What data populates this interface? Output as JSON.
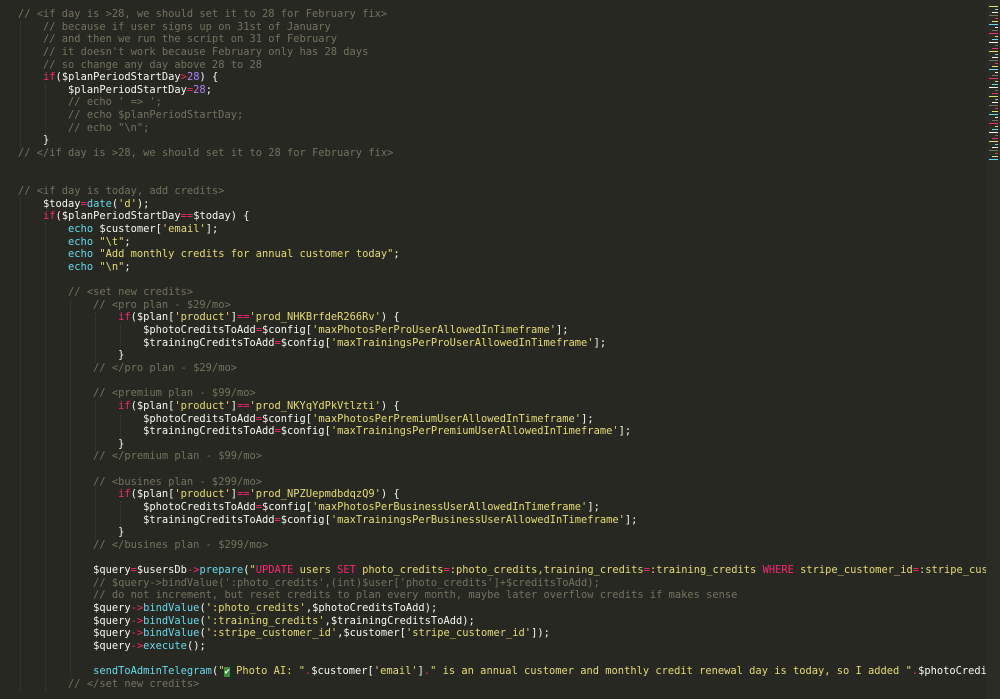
{
  "editor": {
    "lines": [
      {
        "indent": 0,
        "tokens": [
          [
            "c",
            "// <if day is >28, we should set it to 28 for February fix>"
          ]
        ]
      },
      {
        "indent": 1,
        "tokens": [
          [
            "c",
            "// because if user signs up on 31st of January"
          ]
        ]
      },
      {
        "indent": 1,
        "tokens": [
          [
            "c",
            "// and then we run the script on 31 of February"
          ]
        ]
      },
      {
        "indent": 1,
        "tokens": [
          [
            "c",
            "// it doesn't work because February only has 28 days"
          ]
        ]
      },
      {
        "indent": 1,
        "tokens": [
          [
            "c",
            "// so change any day above 28 to 28"
          ]
        ]
      },
      {
        "indent": 1,
        "tokens": [
          [
            "k",
            "if"
          ],
          [
            "p",
            "("
          ],
          [
            "v",
            "$planPeriodStartDay"
          ],
          [
            "o",
            ">"
          ],
          [
            "n",
            "28"
          ],
          [
            "p",
            ") {"
          ]
        ]
      },
      {
        "indent": 2,
        "tokens": [
          [
            "v",
            "$planPeriodStartDay"
          ],
          [
            "o",
            "="
          ],
          [
            "n",
            "28"
          ],
          [
            "p",
            ";"
          ]
        ]
      },
      {
        "indent": 2,
        "tokens": [
          [
            "c",
            "// echo ' => ';"
          ]
        ]
      },
      {
        "indent": 2,
        "tokens": [
          [
            "c",
            "// echo $planPeriodStartDay;"
          ]
        ]
      },
      {
        "indent": 2,
        "tokens": [
          [
            "c",
            "// echo \"\\n\";"
          ]
        ]
      },
      {
        "indent": 1,
        "tokens": [
          [
            "p",
            "}"
          ]
        ]
      },
      {
        "indent": 0,
        "tokens": [
          [
            "c",
            "// </if day is >28, we should set it to 28 for February fix>"
          ]
        ]
      },
      {
        "indent": 0,
        "tokens": []
      },
      {
        "indent": 0,
        "tokens": []
      },
      {
        "indent": 0,
        "tokens": [
          [
            "c",
            "// <if day is today, add credits>"
          ]
        ]
      },
      {
        "indent": 1,
        "tokens": [
          [
            "v",
            "$today"
          ],
          [
            "o",
            "="
          ],
          [
            "f",
            "date"
          ],
          [
            "p",
            "("
          ],
          [
            "s",
            "'d'"
          ],
          [
            "p",
            ");"
          ]
        ]
      },
      {
        "indent": 1,
        "tokens": [
          [
            "k",
            "if"
          ],
          [
            "p",
            "("
          ],
          [
            "v",
            "$planPeriodStartDay"
          ],
          [
            "o",
            "=="
          ],
          [
            "v",
            "$today"
          ],
          [
            "p",
            ") {"
          ]
        ]
      },
      {
        "indent": 2,
        "tokens": [
          [
            "f",
            "echo"
          ],
          [
            "p",
            " "
          ],
          [
            "v",
            "$customer"
          ],
          [
            "p",
            "["
          ],
          [
            "s",
            "'email'"
          ],
          [
            "p",
            "];"
          ]
        ]
      },
      {
        "indent": 2,
        "tokens": [
          [
            "f",
            "echo"
          ],
          [
            "p",
            " "
          ],
          [
            "s",
            "\"\\t\""
          ],
          [
            "p",
            ";"
          ]
        ]
      },
      {
        "indent": 2,
        "tokens": [
          [
            "f",
            "echo"
          ],
          [
            "p",
            " "
          ],
          [
            "s",
            "\"Add monthly credits for annual customer today\""
          ],
          [
            "p",
            ";"
          ]
        ]
      },
      {
        "indent": 2,
        "tokens": [
          [
            "f",
            "echo"
          ],
          [
            "p",
            " "
          ],
          [
            "s",
            "\"\\n\""
          ],
          [
            "p",
            ";"
          ]
        ]
      },
      {
        "indent": 0,
        "tokens": []
      },
      {
        "indent": 2,
        "tokens": [
          [
            "c",
            "// <set new credits>"
          ]
        ]
      },
      {
        "indent": 3,
        "tokens": [
          [
            "c",
            "// <pro plan - $29/mo>"
          ]
        ]
      },
      {
        "indent": 4,
        "tokens": [
          [
            "k",
            "if"
          ],
          [
            "p",
            "("
          ],
          [
            "v",
            "$plan"
          ],
          [
            "p",
            "["
          ],
          [
            "s",
            "'product'"
          ],
          [
            "p",
            "]"
          ],
          [
            "o",
            "=="
          ],
          [
            "s",
            "'prod_NHKBrfdeR266Rv'"
          ],
          [
            "p",
            ") {"
          ]
        ]
      },
      {
        "indent": 5,
        "tokens": [
          [
            "v",
            "$photoCreditsToAdd"
          ],
          [
            "o",
            "="
          ],
          [
            "v",
            "$config"
          ],
          [
            "p",
            "["
          ],
          [
            "s",
            "'maxPhotosPerProUserAllowedInTimeframe'"
          ],
          [
            "p",
            "];"
          ]
        ]
      },
      {
        "indent": 5,
        "tokens": [
          [
            "v",
            "$trainingCreditsToAdd"
          ],
          [
            "o",
            "="
          ],
          [
            "v",
            "$config"
          ],
          [
            "p",
            "["
          ],
          [
            "s",
            "'maxTrainingsPerProUserAllowedInTimeframe'"
          ],
          [
            "p",
            "];"
          ]
        ]
      },
      {
        "indent": 4,
        "tokens": [
          [
            "p",
            "}"
          ]
        ]
      },
      {
        "indent": 3,
        "tokens": [
          [
            "c",
            "// </pro plan - $29/mo>"
          ]
        ]
      },
      {
        "indent": 0,
        "tokens": []
      },
      {
        "indent": 3,
        "tokens": [
          [
            "c",
            "// <premium plan - $99/mo>"
          ]
        ]
      },
      {
        "indent": 4,
        "tokens": [
          [
            "k",
            "if"
          ],
          [
            "p",
            "("
          ],
          [
            "v",
            "$plan"
          ],
          [
            "p",
            "["
          ],
          [
            "s",
            "'product'"
          ],
          [
            "p",
            "]"
          ],
          [
            "o",
            "=="
          ],
          [
            "s",
            "'prod_NKYqYdPkVtlzti'"
          ],
          [
            "p",
            ") {"
          ]
        ]
      },
      {
        "indent": 5,
        "tokens": [
          [
            "v",
            "$photoCreditsToAdd"
          ],
          [
            "o",
            "="
          ],
          [
            "v",
            "$config"
          ],
          [
            "p",
            "["
          ],
          [
            "s",
            "'maxPhotosPerPremiumUserAllowedInTimeframe'"
          ],
          [
            "p",
            "];"
          ]
        ]
      },
      {
        "indent": 5,
        "tokens": [
          [
            "v",
            "$trainingCreditsToAdd"
          ],
          [
            "o",
            "="
          ],
          [
            "v",
            "$config"
          ],
          [
            "p",
            "["
          ],
          [
            "s",
            "'maxTrainingsPerPremiumUserAllowedInTimeframe'"
          ],
          [
            "p",
            "];"
          ]
        ]
      },
      {
        "indent": 4,
        "tokens": [
          [
            "p",
            "}"
          ]
        ]
      },
      {
        "indent": 3,
        "tokens": [
          [
            "c",
            "// </premium plan - $99/mo>"
          ]
        ]
      },
      {
        "indent": 0,
        "tokens": []
      },
      {
        "indent": 3,
        "tokens": [
          [
            "c",
            "// <busines plan - $299/mo>"
          ]
        ]
      },
      {
        "indent": 4,
        "tokens": [
          [
            "k",
            "if"
          ],
          [
            "p",
            "("
          ],
          [
            "v",
            "$plan"
          ],
          [
            "p",
            "["
          ],
          [
            "s",
            "'product'"
          ],
          [
            "p",
            "]"
          ],
          [
            "o",
            "=="
          ],
          [
            "s",
            "'prod_NPZUepmdbdqzQ9'"
          ],
          [
            "p",
            ") {"
          ]
        ]
      },
      {
        "indent": 5,
        "tokens": [
          [
            "v",
            "$photoCreditsToAdd"
          ],
          [
            "o",
            "="
          ],
          [
            "v",
            "$config"
          ],
          [
            "p",
            "["
          ],
          [
            "s",
            "'maxPhotosPerBusinessUserAllowedInTimeframe'"
          ],
          [
            "p",
            "];"
          ]
        ]
      },
      {
        "indent": 5,
        "tokens": [
          [
            "v",
            "$trainingCreditsToAdd"
          ],
          [
            "o",
            "="
          ],
          [
            "v",
            "$config"
          ],
          [
            "p",
            "["
          ],
          [
            "s",
            "'maxTrainingsPerBusinessUserAllowedInTimeframe'"
          ],
          [
            "p",
            "];"
          ]
        ]
      },
      {
        "indent": 4,
        "tokens": [
          [
            "p",
            "}"
          ]
        ]
      },
      {
        "indent": 3,
        "tokens": [
          [
            "c",
            "// </busines plan - $299/mo>"
          ]
        ]
      },
      {
        "indent": 0,
        "tokens": []
      },
      {
        "indent": 3,
        "tokens": [
          [
            "v",
            "$query"
          ],
          [
            "o",
            "="
          ],
          [
            "v",
            "$usersDb"
          ],
          [
            "o",
            "->"
          ],
          [
            "f",
            "prepare"
          ],
          [
            "p",
            "("
          ],
          [
            "s",
            "\""
          ],
          [
            "k",
            "UPDATE"
          ],
          [
            "s",
            " users "
          ],
          [
            "k",
            "SET"
          ],
          [
            "s",
            " photo_credits"
          ],
          [
            "o",
            "="
          ],
          [
            "s",
            ":photo_credits,training_credits"
          ],
          [
            "o",
            "="
          ],
          [
            "s",
            ":training_credits "
          ],
          [
            "k",
            "WHERE"
          ],
          [
            "s",
            " stripe_customer_id"
          ],
          [
            "o",
            "="
          ],
          [
            "s",
            ":stripe_customer_id\""
          ]
        ]
      },
      {
        "indent": 3,
        "tokens": [
          [
            "c",
            "// $query->bindValue(':photo_credits',(int)$user['photo_credits']+$creditsToAdd);"
          ]
        ]
      },
      {
        "indent": 3,
        "tokens": [
          [
            "c",
            "// do not increment, but reset credits to plan every month, maybe later overflow credits if makes sense"
          ]
        ]
      },
      {
        "indent": 3,
        "tokens": [
          [
            "v",
            "$query"
          ],
          [
            "o",
            "->"
          ],
          [
            "f",
            "bindValue"
          ],
          [
            "p",
            "("
          ],
          [
            "s",
            "':photo_credits'"
          ],
          [
            "p",
            ","
          ],
          [
            "v",
            "$photoCreditsToAdd"
          ],
          [
            "p",
            ");"
          ]
        ]
      },
      {
        "indent": 3,
        "tokens": [
          [
            "v",
            "$query"
          ],
          [
            "o",
            "->"
          ],
          [
            "f",
            "bindValue"
          ],
          [
            "p",
            "("
          ],
          [
            "s",
            "':training_credits'"
          ],
          [
            "p",
            ","
          ],
          [
            "v",
            "$trainingCreditsToAdd"
          ],
          [
            "p",
            ");"
          ]
        ]
      },
      {
        "indent": 3,
        "tokens": [
          [
            "v",
            "$query"
          ],
          [
            "o",
            "->"
          ],
          [
            "f",
            "bindValue"
          ],
          [
            "p",
            "("
          ],
          [
            "s",
            "':stripe_customer_id'"
          ],
          [
            "p",
            ","
          ],
          [
            "v",
            "$customer"
          ],
          [
            "p",
            "["
          ],
          [
            "s",
            "'stripe_customer_id'"
          ],
          [
            "p",
            "]);"
          ]
        ]
      },
      {
        "indent": 3,
        "tokens": [
          [
            "v",
            "$query"
          ],
          [
            "o",
            "->"
          ],
          [
            "f",
            "execute"
          ],
          [
            "p",
            "();"
          ]
        ]
      },
      {
        "indent": 0,
        "tokens": []
      },
      {
        "indent": 3,
        "tokens": [
          [
            "f",
            "sendToAdminTelegram"
          ],
          [
            "p",
            "("
          ],
          [
            "s",
            "\""
          ],
          [
            "e",
            "✔"
          ],
          [
            "s",
            " Photo AI: \""
          ],
          [
            "o",
            "."
          ],
          [
            "v",
            "$customer"
          ],
          [
            "p",
            "["
          ],
          [
            "s",
            "'email'"
          ],
          [
            "p",
            "]"
          ],
          [
            "o",
            "."
          ],
          [
            "s",
            "\" is an annual customer and monthly credit renewal day is today, so I added \""
          ],
          [
            "o",
            "."
          ],
          [
            "v",
            "$photoCreditsToAdd"
          ]
        ]
      },
      {
        "indent": 2,
        "tokens": [
          [
            "c",
            "// </set new credits>"
          ]
        ]
      }
    ]
  }
}
